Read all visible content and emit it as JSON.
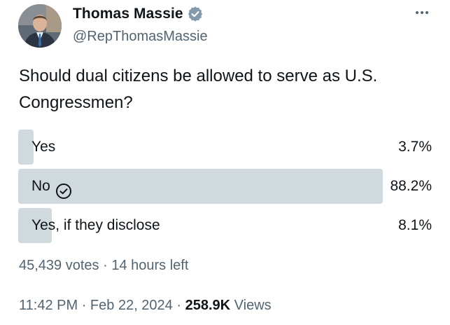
{
  "author": {
    "name": "Thomas Massie",
    "handle": "@RepThomasMassie",
    "verified_color": "#829aab"
  },
  "question": "Should dual citizens be allowed to serve as U.S. Congressmen?",
  "poll": {
    "options": [
      {
        "label": "Yes",
        "percent": "3.7%",
        "value": 3.7,
        "selected": false
      },
      {
        "label": "No",
        "percent": "88.2%",
        "value": 88.2,
        "selected": true
      },
      {
        "label": "Yes, if they disclose",
        "percent": "8.1%",
        "value": 8.1,
        "selected": false
      }
    ],
    "votes": "45,439 votes",
    "separator": "·",
    "time_left": "14 hours left",
    "bar_color": "#cfd9de"
  },
  "footer": {
    "time": "11:42 PM",
    "date": "Feb 22, 2024",
    "views_count": "258.9K",
    "views_label": "Views",
    "separator": "·"
  }
}
